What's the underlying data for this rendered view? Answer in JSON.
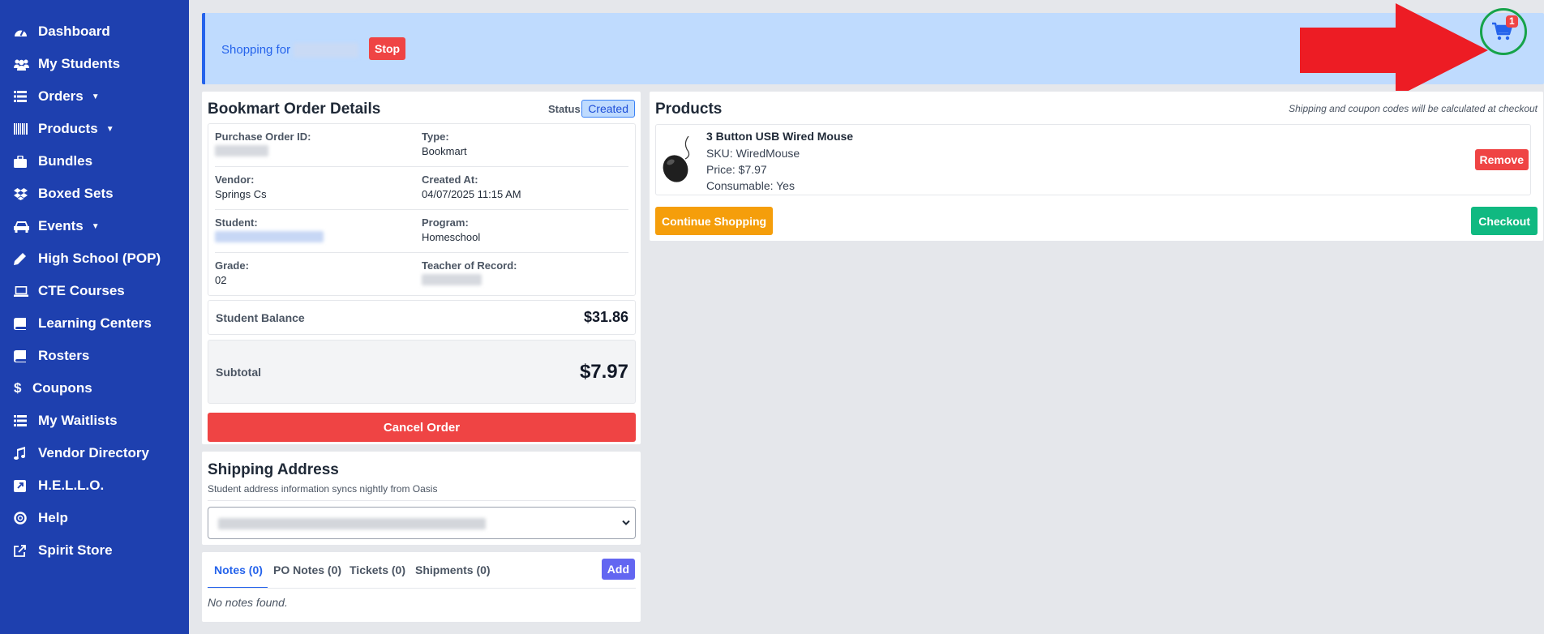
{
  "sidebar": {
    "items": [
      {
        "label": "Dashboard",
        "icon": "dashboard-icon"
      },
      {
        "label": "My Students",
        "icon": "users-icon"
      },
      {
        "label": "Orders",
        "icon": "list-icon",
        "dropdown": true
      },
      {
        "label": "Products",
        "icon": "barcode-icon",
        "dropdown": true
      },
      {
        "label": "Bundles",
        "icon": "briefcase-icon"
      },
      {
        "label": "Boxed Sets",
        "icon": "dropbox-icon"
      },
      {
        "label": "Events",
        "icon": "car-icon",
        "dropdown": true
      },
      {
        "label": "High School (POP)",
        "icon": "pencil-icon"
      },
      {
        "label": "CTE Courses",
        "icon": "laptop-icon"
      },
      {
        "label": "Learning Centers",
        "icon": "book-icon"
      },
      {
        "label": "Rosters",
        "icon": "book-icon"
      },
      {
        "label": "Coupons",
        "icon": "dollar-icon"
      },
      {
        "label": "My Waitlists",
        "icon": "list-icon"
      },
      {
        "label": "Vendor Directory",
        "icon": "music-icon"
      },
      {
        "label": "H.E.L.L.O.",
        "icon": "external-square-icon"
      },
      {
        "label": "Help",
        "icon": "lifebuoy-icon"
      },
      {
        "label": "Spirit Store",
        "icon": "external-link-icon"
      }
    ]
  },
  "banner": {
    "shopping_for": "Shopping for",
    "stop_label": "Stop",
    "cart_count": "1"
  },
  "order": {
    "title": "Bookmart Order Details",
    "status_label": "Status:",
    "status_value": "Created",
    "fields": {
      "po_label": "Purchase Order ID:",
      "type_label": "Type:",
      "type_value": "Bookmart",
      "vendor_label": "Vendor:",
      "vendor_value": "Springs Cs",
      "created_label": "Created At:",
      "created_value": "04/07/2025 11:15 AM",
      "student_label": "Student:",
      "program_label": "Program:",
      "program_value": "Homeschool",
      "grade_label": "Grade:",
      "grade_value": "02",
      "teacher_label": "Teacher of Record:"
    },
    "balance_label": "Student Balance",
    "balance_value": "$31.86",
    "subtotal_label": "Subtotal",
    "subtotal_value": "$7.97",
    "cancel_label": "Cancel Order"
  },
  "shipping": {
    "title": "Shipping Address",
    "subtitle": "Student address information syncs nightly from Oasis"
  },
  "notes": {
    "tabs": [
      "Notes (0)",
      "PO Notes (0)",
      "Tickets (0)",
      "Shipments (0)"
    ],
    "add_label": "Add",
    "empty": "No notes found."
  },
  "products": {
    "title": "Products",
    "note": "Shipping and coupon codes will be calculated at checkout",
    "items": [
      {
        "name": "3 Button USB Wired Mouse",
        "sku": "SKU: WiredMouse",
        "price": "Price: $7.97",
        "consumable": "Consumable: Yes"
      }
    ],
    "remove_label": "Remove",
    "continue_label": "Continue Shopping",
    "checkout_label": "Checkout"
  },
  "colors": {
    "sidebar": "#1e40af",
    "banner": "#bfdbfe",
    "danger": "#ef4444",
    "warning": "#f59e0b",
    "success": "#10b981",
    "accent": "#6366f1",
    "annotation_arrow": "#ed1c24",
    "annotation_circle": "#16a34a"
  }
}
